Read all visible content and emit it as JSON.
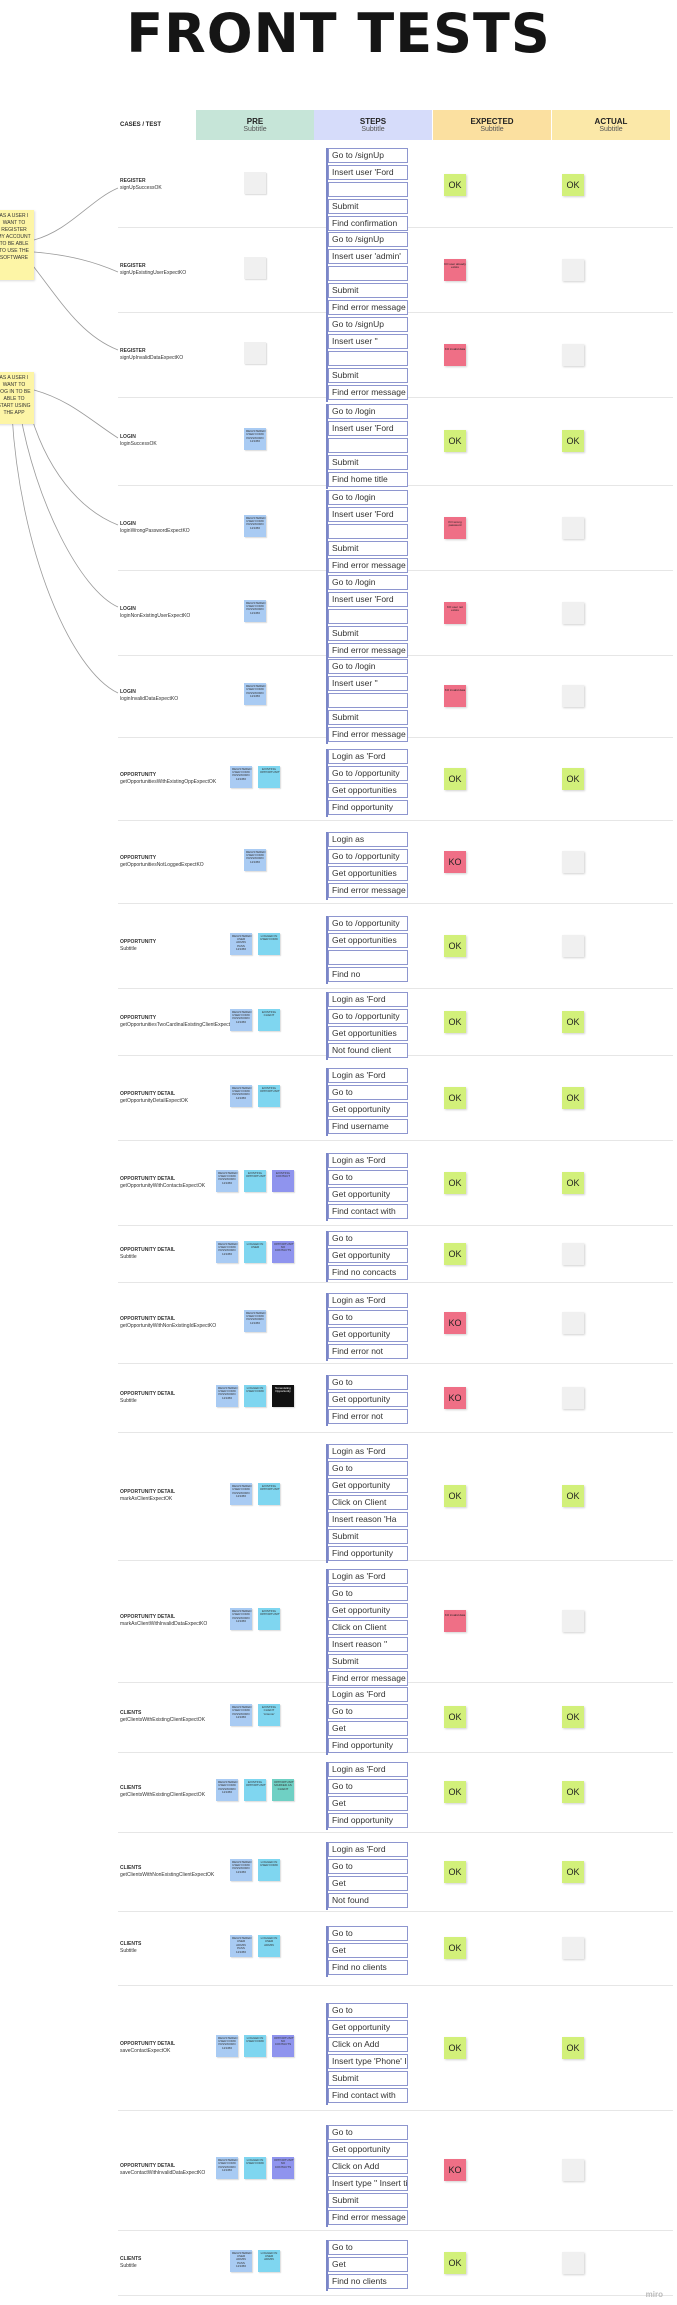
{
  "title": "FRONT TESTS",
  "header": {
    "case_label": "CASES / TEST",
    "columns": [
      {
        "label": "PRE",
        "sub": "Subtitle",
        "color": "#c6e5d8"
      },
      {
        "label": "STEPS",
        "sub": "Subtitle",
        "color": "#d6dcfa"
      },
      {
        "label": "EXPECTED",
        "sub": "Subtitle",
        "color": "#fbe0a0"
      },
      {
        "label": "ACTUAL",
        "sub": "Subtitle",
        "color": "#fbe8a8"
      }
    ]
  },
  "sidenotes": [
    {
      "text": "AS A USER I WANT TO REGISTER MY ACCOUNT TO BE ABLE TO USE THE SOFTWARE"
    },
    {
      "text": "AS A USER I WANT TO LOG IN TO BE ABLE TO START USING THE APP"
    }
  ],
  "rows": [
    {
      "category": "REGISTER",
      "test": "signUpSuccessOK",
      "pre": [
        {
          "t": "",
          "c": "blank"
        }
      ],
      "steps": [
        "Go to /signUp",
        "Insert user 'Ford",
        "",
        "Submit",
        "Find confirmation"
      ],
      "expected": {
        "status": "ok",
        "text": "OK"
      },
      "actual": {
        "status": "ok",
        "text": "OK"
      }
    },
    {
      "category": "REGISTER",
      "test": "signUpExistingUserExpectKO",
      "pre": [
        {
          "t": "",
          "c": "blank"
        }
      ],
      "steps": [
        "Go to /signUp",
        "Insert user 'admin'",
        "",
        "Submit",
        "Find error message"
      ],
      "expected": {
        "status": "ko",
        "text": "KO user already exists"
      },
      "actual": {
        "status": "blank",
        "text": ""
      }
    },
    {
      "category": "REGISTER",
      "test": "signUpInvalidDataExpectKO",
      "pre": [
        {
          "t": "",
          "c": "blank"
        }
      ],
      "steps": [
        "Go to /signUp",
        "Insert user ''",
        "",
        "Submit",
        "Find error message"
      ],
      "expected": {
        "status": "ko",
        "text": "KO invalid data"
      },
      "actual": {
        "status": "blank",
        "text": ""
      }
    },
    {
      "category": "LOGIN",
      "test": "loginSuccessOK",
      "pre": [
        {
          "t": "REGISTERED USER FORD PASSWORD 123456",
          "c": "blue"
        }
      ],
      "steps": [
        "Go to /login",
        "Insert user 'Ford",
        "",
        "Submit",
        "Find home title"
      ],
      "expected": {
        "status": "ok",
        "text": "OK"
      },
      "actual": {
        "status": "ok",
        "text": "OK"
      }
    },
    {
      "category": "LOGIN",
      "test": "loginWrongPasswordExpectKO",
      "pre": [
        {
          "t": "REGISTERED USER FORD PASSWORD 123456",
          "c": "blue"
        }
      ],
      "steps": [
        "Go to /login",
        "Insert user 'Ford",
        "",
        "Submit",
        "Find error message"
      ],
      "expected": {
        "status": "ko",
        "text": "KO wrong password"
      },
      "actual": {
        "status": "blank",
        "text": ""
      }
    },
    {
      "category": "LOGIN",
      "test": "loginNonExistingUserExpectKO",
      "pre": [
        {
          "t": "REGISTERED USER FORD PASSWORD 123456",
          "c": "blue"
        }
      ],
      "steps": [
        "Go to /login",
        "Insert user 'Ford",
        "",
        "Submit",
        "Find error message"
      ],
      "expected": {
        "status": "ko",
        "text": "KO user not exists"
      },
      "actual": {
        "status": "blank",
        "text": ""
      }
    },
    {
      "category": "LOGIN",
      "test": "loginInvalidDataExpectKO",
      "pre": [
        {
          "t": "REGISTERED USER FORD PASSWORD 123456",
          "c": "blue"
        }
      ],
      "steps": [
        "Go to /login",
        "Insert user ''",
        "",
        "Submit",
        "Find error message"
      ],
      "expected": {
        "status": "ko",
        "text": "KO invalid data"
      },
      "actual": {
        "status": "blank",
        "text": ""
      }
    },
    {
      "category": "OPPORTUNITY",
      "test": "getOpportunitiesWithExistingOppExpectOK",
      "pre": [
        {
          "t": "REGISTERED USER FORD PASSWORD 123456",
          "c": "blue"
        },
        {
          "t": "EXISTING OPPORTUNITY",
          "c": "cyan"
        }
      ],
      "steps": [
        "Login as 'Ford",
        "Go to /opportunity",
        "Get opportunities",
        "Find opportunity"
      ],
      "expected": {
        "status": "ok",
        "text": "OK"
      },
      "actual": {
        "status": "ok",
        "text": "OK"
      }
    },
    {
      "category": "OPPORTUNITY",
      "test": "getOpportunitiesNotLoggedExpectKO",
      "pre": [
        {
          "t": "REGISTERED USER FORD PASSWORD 123456",
          "c": "blue"
        }
      ],
      "steps": [
        "Login as",
        "Go to /opportunity",
        "Get opportunities",
        "Find error message"
      ],
      "expected": {
        "status": "ko",
        "text": "KO"
      },
      "actual": {
        "status": "blank",
        "text": ""
      }
    },
    {
      "category": "OPPORTUNITY",
      "test": "Subtitle",
      "pre": [
        {
          "t": "REGISTERED USER ADMIN PASS 123456",
          "c": "blue"
        },
        {
          "t": "LOGGED IN USER FORD",
          "c": "cyan"
        }
      ],
      "steps": [
        "Go to /opportunity",
        "Get opportunities",
        "",
        "Find no"
      ],
      "expected": {
        "status": "ok",
        "text": "OK"
      },
      "actual": {
        "status": "blank",
        "text": ""
      }
    },
    {
      "category": "OPPORTUNITY",
      "test": "getOpportunitiesTwoCardinalExistingClientExpectOK",
      "pre": [
        {
          "t": "REGISTERED USER FORD PASSWORD 123456",
          "c": "blue"
        },
        {
          "t": "EXISTING CLIENT",
          "c": "cyan"
        }
      ],
      "steps": [
        "Login as 'Ford",
        "Go to /opportunity",
        "Get opportunities",
        "Not found client"
      ],
      "expected": {
        "status": "ok",
        "text": "OK"
      },
      "actual": {
        "status": "ok",
        "text": "OK"
      }
    },
    {
      "category": "OPPORTUNITY DETAIL",
      "test": "getOpportunityDetailExpectOK",
      "pre": [
        {
          "t": "REGISTERED USER FORD PASSWORD 123456",
          "c": "blue"
        },
        {
          "t": "EXISTING OPPORTUNITY",
          "c": "cyan"
        }
      ],
      "steps": [
        "Login as 'Ford",
        "Go to",
        "Get opportunity",
        "Find username"
      ],
      "expected": {
        "status": "ok",
        "text": "OK"
      },
      "actual": {
        "status": "ok",
        "text": "OK"
      }
    },
    {
      "category": "OPPORTUNITY DETAIL",
      "test": "getOpportunityWithContactsExpectOK",
      "pre": [
        {
          "t": "REGISTERED USER FORD PASSWORD 123456",
          "c": "blue"
        },
        {
          "t": "EXISTING OPPORTUNITY",
          "c": "cyan"
        },
        {
          "t": "EXISTING CONTACT",
          "c": "purple"
        }
      ],
      "steps": [
        "Login as 'Ford",
        "Go to",
        "Get opportunity",
        "Find contact with"
      ],
      "expected": {
        "status": "ok",
        "text": "OK"
      },
      "actual": {
        "status": "ok",
        "text": "OK"
      }
    },
    {
      "category": "OPPORTUNITY DETAIL",
      "test": "Subtitle",
      "pre": [
        {
          "t": "REGISTERED USER FORD PASSWORD 123456",
          "c": "blue"
        },
        {
          "t": "LOGGED IN USER",
          "c": "cyan"
        },
        {
          "t": "OPPORTUNITY NO CONTACTS",
          "c": "purple"
        }
      ],
      "steps": [
        "Go to",
        "Get opportunity",
        "Find no concacts"
      ],
      "expected": {
        "status": "ok",
        "text": "OK"
      },
      "actual": {
        "status": "blank",
        "text": ""
      }
    },
    {
      "category": "OPPORTUNITY DETAIL",
      "test": "getOpportunityWithNonExistingIdExpectKO",
      "pre": [
        {
          "t": "REGISTERED USER FORD PASSWORD 123456",
          "c": "blue"
        }
      ],
      "steps": [
        "Login as 'Ford",
        "Go to",
        "Get opportunity",
        "Find error not"
      ],
      "expected": {
        "status": "ko",
        "text": "KO"
      },
      "actual": {
        "status": "blank",
        "text": ""
      }
    },
    {
      "category": "OPPORTUNITY DETAIL",
      "test": "Subtitle",
      "pre": [
        {
          "t": "REGISTERED USER FORD PASSWORD 123456",
          "c": "blue"
        },
        {
          "t": "LOGGED IN USER FORD",
          "c": "cyan"
        },
        {
          "t": "Nonexisting Opportunity",
          "c": "black"
        }
      ],
      "steps": [
        "Go to",
        "Get opportunity",
        "Find error not"
      ],
      "expected": {
        "status": "ko",
        "text": "KO"
      },
      "actual": {
        "status": "blank",
        "text": ""
      }
    },
    {
      "category": "OPPORTUNITY DETAIL",
      "test": "markAsClientExpectOK",
      "pre": [
        {
          "t": "REGISTERED USER FORD PASSWORD 123456",
          "c": "blue"
        },
        {
          "t": "EXISTING OPPORTUNITY",
          "c": "cyan"
        }
      ],
      "steps": [
        "Login as 'Ford",
        "Go to",
        "Get opportunity",
        "Click on Client",
        "Insert reason 'Ha",
        "Submit",
        "Find opportunity"
      ],
      "expected": {
        "status": "ok",
        "text": "OK"
      },
      "actual": {
        "status": "ok",
        "text": "OK"
      }
    },
    {
      "category": "OPPORTUNITY DETAIL",
      "test": "markAsClientWithInvalidDataExpectKO",
      "pre": [
        {
          "t": "REGISTERED USER FORD PASSWORD 123456",
          "c": "blue"
        },
        {
          "t": "EXISTING OPPORTUNITY",
          "c": "cyan"
        }
      ],
      "steps": [
        "Login as 'Ford",
        "Go to",
        "Get opportunity",
        "Click on Client",
        "Insert reason ''",
        "Submit",
        "Find error message"
      ],
      "expected": {
        "status": "ko",
        "text": "KO invalid data"
      },
      "actual": {
        "status": "blank",
        "text": ""
      }
    },
    {
      "category": "CLIENTS",
      "test": "getClientsWithExistingClientExpectOK",
      "pre": [
        {
          "t": "REGISTERED USER FORD PASSWORD 123456",
          "c": "blue"
        },
        {
          "t": "EXISTING CLIENT 'Antonio'",
          "c": "cyan"
        }
      ],
      "steps": [
        "Login as 'Ford",
        "Go to",
        "Get",
        "Find opportunity"
      ],
      "expected": {
        "status": "ok",
        "text": "OK"
      },
      "actual": {
        "status": "ok",
        "text": "OK"
      }
    },
    {
      "category": "CLIENTS",
      "test": "getClientsWithExistingClientExpectOK",
      "pre": [
        {
          "t": "REGISTERED USER FORD PASSWORD 123456",
          "c": "blue"
        },
        {
          "t": "EXISTING OPPORTUNITY",
          "c": "cyan"
        },
        {
          "t": "OPPORTUNITY MARKED AS CLIENT",
          "c": "teal"
        }
      ],
      "steps": [
        "Login as 'Ford",
        "Go to",
        "Get",
        "Find opportunity"
      ],
      "expected": {
        "status": "ok",
        "text": "OK"
      },
      "actual": {
        "status": "ok",
        "text": "OK"
      }
    },
    {
      "category": "CLIENTS",
      "test": "getClientsWithNonExistingClientExpectOK",
      "pre": [
        {
          "t": "REGISTERED USER FORD PASSWORD 123456",
          "c": "blue"
        },
        {
          "t": "LOGGED IN USER FORD",
          "c": "cyan"
        }
      ],
      "steps": [
        "Login as 'Ford",
        "Go to",
        "Get",
        "Not found"
      ],
      "expected": {
        "status": "ok",
        "text": "OK"
      },
      "actual": {
        "status": "ok",
        "text": "OK"
      }
    },
    {
      "category": "CLIENTS",
      "test": "Subtitle",
      "pre": [
        {
          "t": "REGISTERED USER ADMIN PASS 123456",
          "c": "blue"
        },
        {
          "t": "LOGGED IN USER ADMIN",
          "c": "cyan"
        }
      ],
      "steps": [
        "Go to",
        "Get",
        "Find no clients"
      ],
      "expected": {
        "status": "ok",
        "text": "OK"
      },
      "actual": {
        "status": "blank",
        "text": ""
      }
    },
    {
      "category": "OPPORTUNITY DETAIL",
      "test": "saveContactExpectOK",
      "pre": [
        {
          "t": "REGISTERED USER FORD PASSWORD 123456",
          "c": "blue"
        },
        {
          "t": "LOGGED IN USER FORD",
          "c": "cyan"
        },
        {
          "t": "OPPORTUNITY NO CONTACTS",
          "c": "purple"
        }
      ],
      "steps": [
        "Go to",
        "Get opportunity",
        "Click on Add",
        "Insert type 'Phone' Insert title",
        "Submit",
        "Find contact with"
      ],
      "expected": {
        "status": "ok",
        "text": "OK"
      },
      "actual": {
        "status": "ok",
        "text": "OK"
      }
    },
    {
      "category": "OPPORTUNITY DETAIL",
      "test": "saveContactWithInvalidDataExpectKO",
      "pre": [
        {
          "t": "REGISTERED USER FORD PASSWORD 123456",
          "c": "blue"
        },
        {
          "t": "LOGGED IN USER FORD",
          "c": "cyan"
        },
        {
          "t": "OPPORTUNITY NO CONTACTS",
          "c": "purple"
        }
      ],
      "steps": [
        "Go to",
        "Get opportunity",
        "Click on Add",
        "Insert type '' Insert title ''",
        "Submit",
        "Find error message"
      ],
      "expected": {
        "status": "ko",
        "text": "KO"
      },
      "actual": {
        "status": "blank",
        "text": ""
      }
    },
    {
      "category": "CLIENTS",
      "test": "Subtitle",
      "pre": [
        {
          "t": "REGISTERED USER ADMIN PASS 123456",
          "c": "blue"
        },
        {
          "t": "LOGGED IN USER ADMIN",
          "c": "cyan"
        }
      ],
      "steps": [
        "Go to",
        "Get",
        "Find no clients"
      ],
      "expected": {
        "status": "ok",
        "text": "OK"
      },
      "actual": {
        "status": "blank",
        "text": ""
      }
    }
  ],
  "colors": {
    "blue": "#a9cbf3",
    "cyan": "#7fd6f0",
    "purple": "#8f94ee",
    "black": "#111111",
    "teal": "#6fd0c4",
    "blank": "#f0f0f0"
  },
  "footer": "miro"
}
